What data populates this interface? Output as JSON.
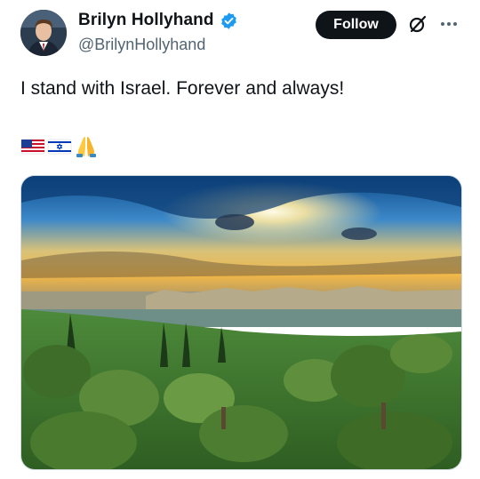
{
  "post": {
    "author_name": "Brilyn Hollyhand",
    "author_handle": "@BrilynHollyhand",
    "follow_label": "Follow",
    "text": "I stand with Israel. Forever and always!",
    "emojis": [
      "us-flag-icon",
      "israel-flag-icon",
      "folded-hands-icon"
    ],
    "verified": true
  },
  "colors": {
    "verified_blue": "#1d9bf0",
    "follow_bg": "#0f1419",
    "secondary_text": "#536471"
  },
  "icons": {
    "grok": "grok-slash-circle-icon",
    "more": "more-options-icon"
  }
}
